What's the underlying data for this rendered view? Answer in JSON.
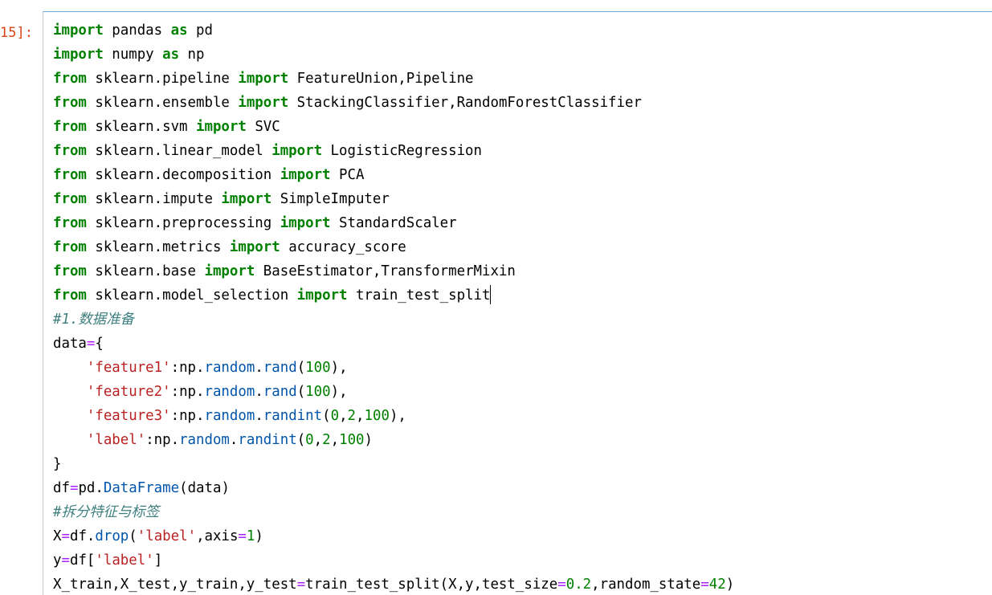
{
  "cell": {
    "prompt": "15]:",
    "lines": [
      [
        {
          "t": "kw",
          "v": "import"
        },
        {
          "t": "plain",
          "v": " pandas "
        },
        {
          "t": "kw",
          "v": "as"
        },
        {
          "t": "plain",
          "v": " pd"
        }
      ],
      [
        {
          "t": "kw",
          "v": "import"
        },
        {
          "t": "plain",
          "v": " numpy "
        },
        {
          "t": "kw",
          "v": "as"
        },
        {
          "t": "plain",
          "v": " np"
        }
      ],
      [
        {
          "t": "kw",
          "v": "from"
        },
        {
          "t": "plain",
          "v": " sklearn.pipeline "
        },
        {
          "t": "kw",
          "v": "import"
        },
        {
          "t": "plain",
          "v": " FeatureUnion,Pipeline"
        }
      ],
      [
        {
          "t": "kw",
          "v": "from"
        },
        {
          "t": "plain",
          "v": " sklearn.ensemble "
        },
        {
          "t": "kw",
          "v": "import"
        },
        {
          "t": "plain",
          "v": " StackingClassifier,RandomForestClassifier"
        }
      ],
      [
        {
          "t": "kw",
          "v": "from"
        },
        {
          "t": "plain",
          "v": " sklearn.svm "
        },
        {
          "t": "kw",
          "v": "import"
        },
        {
          "t": "plain",
          "v": " SVC"
        }
      ],
      [
        {
          "t": "kw",
          "v": "from"
        },
        {
          "t": "plain",
          "v": " sklearn.linear_model "
        },
        {
          "t": "kw",
          "v": "import"
        },
        {
          "t": "plain",
          "v": " LogisticRegression"
        }
      ],
      [
        {
          "t": "kw",
          "v": "from"
        },
        {
          "t": "plain",
          "v": " sklearn.decomposition "
        },
        {
          "t": "kw",
          "v": "import"
        },
        {
          "t": "plain",
          "v": " PCA"
        }
      ],
      [
        {
          "t": "kw",
          "v": "from"
        },
        {
          "t": "plain",
          "v": " sklearn.impute "
        },
        {
          "t": "kw",
          "v": "import"
        },
        {
          "t": "plain",
          "v": " SimpleImputer"
        }
      ],
      [
        {
          "t": "kw",
          "v": "from"
        },
        {
          "t": "plain",
          "v": " sklearn.preprocessing "
        },
        {
          "t": "kw",
          "v": "import"
        },
        {
          "t": "plain",
          "v": " StandardScaler"
        }
      ],
      [
        {
          "t": "kw",
          "v": "from"
        },
        {
          "t": "plain",
          "v": " sklearn.metrics "
        },
        {
          "t": "kw",
          "v": "import"
        },
        {
          "t": "plain",
          "v": " accuracy_score"
        }
      ],
      [
        {
          "t": "kw",
          "v": "from"
        },
        {
          "t": "plain",
          "v": " sklearn.base "
        },
        {
          "t": "kw",
          "v": "import"
        },
        {
          "t": "plain",
          "v": " BaseEstimator,TransformerMixin"
        }
      ],
      [
        {
          "t": "kw",
          "v": "from"
        },
        {
          "t": "plain",
          "v": " sklearn.model_selection "
        },
        {
          "t": "kw",
          "v": "import"
        },
        {
          "t": "plain",
          "v": " train_test_split"
        },
        {
          "t": "cursor",
          "v": ""
        }
      ],
      [
        {
          "t": "comment",
          "v": "#1.数据准备"
        }
      ],
      [
        {
          "t": "plain",
          "v": "data"
        },
        {
          "t": "op",
          "v": "="
        },
        {
          "t": "plain",
          "v": "{"
        }
      ],
      [
        {
          "t": "plain",
          "v": "    "
        },
        {
          "t": "str",
          "v": "'feature1'"
        },
        {
          "t": "plain",
          "v": ":np."
        },
        {
          "t": "attr",
          "v": "random"
        },
        {
          "t": "plain",
          "v": "."
        },
        {
          "t": "attr",
          "v": "rand"
        },
        {
          "t": "plain",
          "v": "("
        },
        {
          "t": "num",
          "v": "100"
        },
        {
          "t": "plain",
          "v": "),"
        }
      ],
      [
        {
          "t": "plain",
          "v": "    "
        },
        {
          "t": "str",
          "v": "'feature2'"
        },
        {
          "t": "plain",
          "v": ":np."
        },
        {
          "t": "attr",
          "v": "random"
        },
        {
          "t": "plain",
          "v": "."
        },
        {
          "t": "attr",
          "v": "rand"
        },
        {
          "t": "plain",
          "v": "("
        },
        {
          "t": "num",
          "v": "100"
        },
        {
          "t": "plain",
          "v": "),"
        }
      ],
      [
        {
          "t": "plain",
          "v": "    "
        },
        {
          "t": "str",
          "v": "'feature3'"
        },
        {
          "t": "plain",
          "v": ":np."
        },
        {
          "t": "attr",
          "v": "random"
        },
        {
          "t": "plain",
          "v": "."
        },
        {
          "t": "attr",
          "v": "randint"
        },
        {
          "t": "plain",
          "v": "("
        },
        {
          "t": "num",
          "v": "0"
        },
        {
          "t": "plain",
          "v": ","
        },
        {
          "t": "num",
          "v": "2"
        },
        {
          "t": "plain",
          "v": ","
        },
        {
          "t": "num",
          "v": "100"
        },
        {
          "t": "plain",
          "v": "),"
        }
      ],
      [
        {
          "t": "plain",
          "v": "    "
        },
        {
          "t": "str",
          "v": "'label'"
        },
        {
          "t": "plain",
          "v": ":np."
        },
        {
          "t": "attr",
          "v": "random"
        },
        {
          "t": "plain",
          "v": "."
        },
        {
          "t": "attr",
          "v": "randint"
        },
        {
          "t": "plain",
          "v": "("
        },
        {
          "t": "num",
          "v": "0"
        },
        {
          "t": "plain",
          "v": ","
        },
        {
          "t": "num",
          "v": "2"
        },
        {
          "t": "plain",
          "v": ","
        },
        {
          "t": "num",
          "v": "100"
        },
        {
          "t": "plain",
          "v": ")"
        }
      ],
      [
        {
          "t": "plain",
          "v": "}"
        }
      ],
      [
        {
          "t": "plain",
          "v": "df"
        },
        {
          "t": "op",
          "v": "="
        },
        {
          "t": "plain",
          "v": "pd."
        },
        {
          "t": "attr",
          "v": "DataFrame"
        },
        {
          "t": "plain",
          "v": "(data)"
        }
      ],
      [
        {
          "t": "comment",
          "v": "#拆分特征与标签"
        }
      ],
      [
        {
          "t": "plain",
          "v": "X"
        },
        {
          "t": "op",
          "v": "="
        },
        {
          "t": "plain",
          "v": "df."
        },
        {
          "t": "attr",
          "v": "drop"
        },
        {
          "t": "plain",
          "v": "("
        },
        {
          "t": "str",
          "v": "'label'"
        },
        {
          "t": "plain",
          "v": ",axis"
        },
        {
          "t": "op",
          "v": "="
        },
        {
          "t": "num",
          "v": "1"
        },
        {
          "t": "plain",
          "v": ")"
        }
      ],
      [
        {
          "t": "plain",
          "v": "y"
        },
        {
          "t": "op",
          "v": "="
        },
        {
          "t": "plain",
          "v": "df["
        },
        {
          "t": "str",
          "v": "'label'"
        },
        {
          "t": "plain",
          "v": "]"
        }
      ],
      [
        {
          "t": "plain",
          "v": "X_train,X_test,y_train,y_test"
        },
        {
          "t": "op",
          "v": "="
        },
        {
          "t": "plain",
          "v": "train_test_split(X,y,test_size"
        },
        {
          "t": "op",
          "v": "="
        },
        {
          "t": "num",
          "v": "0.2"
        },
        {
          "t": "plain",
          "v": ",random_state"
        },
        {
          "t": "op",
          "v": "="
        },
        {
          "t": "num",
          "v": "42"
        },
        {
          "t": "plain",
          "v": ")"
        }
      ]
    ]
  }
}
